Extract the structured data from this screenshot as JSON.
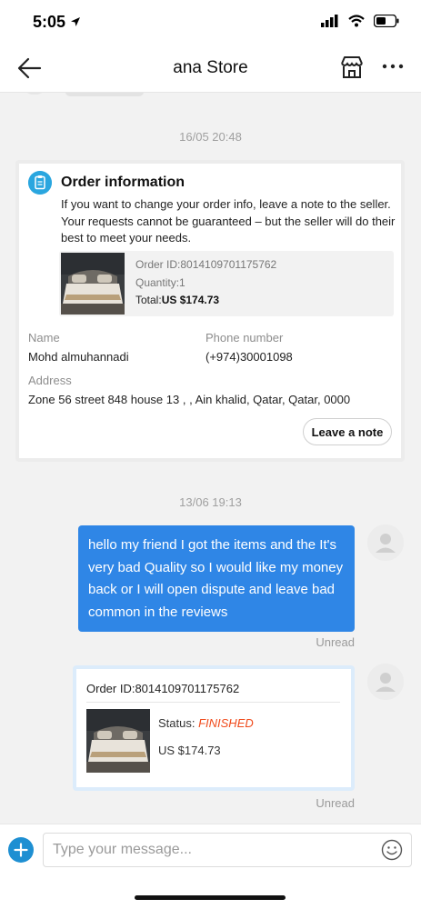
{
  "status_bar": {
    "time": "5:05"
  },
  "nav": {
    "title": "ana Store"
  },
  "messages": {
    "timestamp_1": "16/05 20:48",
    "order_info": {
      "title": "Order information",
      "description": "If you want to change your order info, leave a note to the seller. Your requests cannot be guaranteed – but the seller will do their best to meet your needs.",
      "order_id": "Order ID:8014109701175762",
      "quantity": "Quantity:1",
      "total_label": "Total:",
      "total_value": "US $174.73",
      "name_label": "Name",
      "name_value": "Mohd almuhannadi",
      "phone_label": "Phone number",
      "phone_value": "(+974)30001098",
      "address_label": "Address",
      "address_value": "Zone 56 street 848 house 13 , , Ain khalid, Qatar, Qatar, 0000",
      "leave_note_label": "Leave a note"
    },
    "timestamp_2": "13/06 19:13",
    "user_message": {
      "text": "hello my friend I got the items and the It's very bad Quality so I would like my money back or I will open dispute and leave bad common in the reviews",
      "read_status": "Unread"
    },
    "order_card": {
      "order_id": "Order ID:8014109701175762",
      "status_label": "Status: ",
      "status_value": "FINISHED",
      "price": "US $174.73",
      "read_status": "Unread"
    }
  },
  "input": {
    "placeholder": "Type your message..."
  },
  "colors": {
    "accent_blue": "#2f86e6",
    "status_finished": "#f04b1c",
    "plus_button": "#1e8fd2"
  },
  "icons": [
    "back-arrow-icon",
    "store-icon",
    "more-icon",
    "order-info-icon",
    "plus-icon",
    "emoji-icon",
    "avatar-icon"
  ]
}
